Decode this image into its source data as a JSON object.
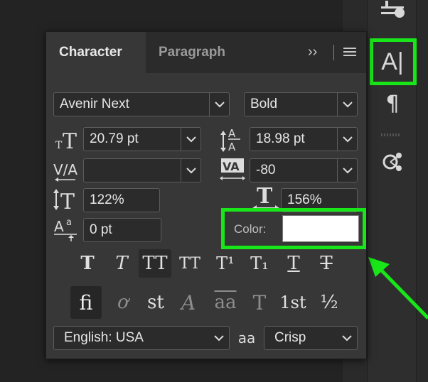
{
  "panel": {
    "tabs": [
      {
        "label": "Character",
        "active": true
      },
      {
        "label": "Paragraph",
        "active": false
      }
    ],
    "overflow_icon": "double-chevron-right-icon",
    "menu_icon": "hamburger-menu-icon"
  },
  "font": {
    "family": "Avenir Next",
    "style": "Bold"
  },
  "metrics": {
    "size": "20.79 pt",
    "leading": "18.98 pt",
    "kerning": "",
    "tracking": "-80",
    "vertical_scale": "122%",
    "horizontal_scale": "156%",
    "baseline_shift": "0 pt"
  },
  "color": {
    "label": "Color:",
    "value": "#ffffff"
  },
  "type_styles": {
    "faux_bold": "T",
    "faux_italic": "T",
    "all_caps": "TT",
    "small_caps": "TT",
    "superscript": "T¹",
    "subscript": "T₁",
    "underline": "T",
    "strikethrough": "T"
  },
  "opentype": {
    "ligatures": "fi",
    "discretionary": "ơ",
    "st_ligature": "st",
    "swash": "A",
    "titling": "aa",
    "stylistic": "T",
    "ordinals": "1st",
    "fractions": "½"
  },
  "language": "English: USA",
  "aa_glyph": "aa",
  "antialias": "Crisp",
  "highlight_color": "#19e619"
}
